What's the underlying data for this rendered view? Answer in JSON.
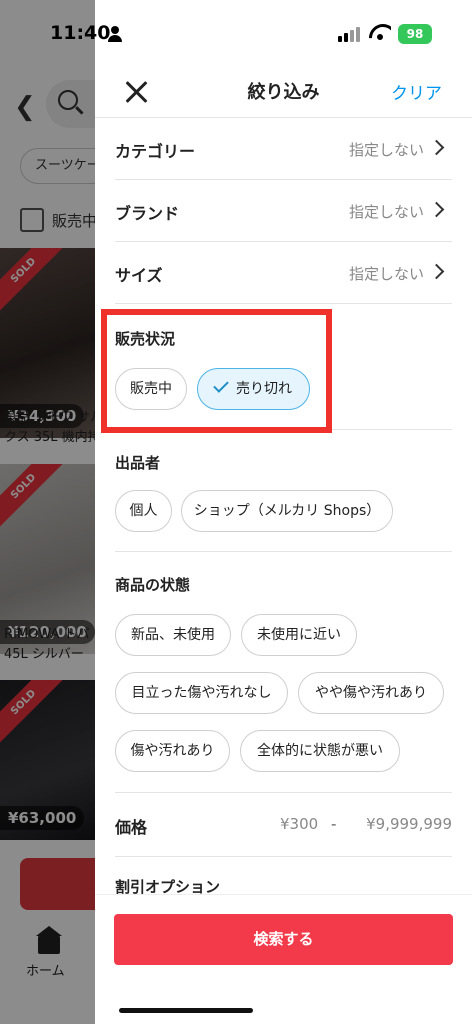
{
  "status_bar": {
    "time": "11:40",
    "battery": "98"
  },
  "background": {
    "chip_text": "スーツケー",
    "checkbox_label": "販売中",
    "sold_label": "SOLD",
    "items": [
      {
        "price": "¥34,300",
        "title_line1": "良品 リモワ サル",
        "title_line2": "クス 35L 機内持"
      },
      {
        "price": "¥120,000",
        "title_line1": "RIMOWA トパ",
        "title_line2": "45L シルバー"
      },
      {
        "price": "¥63,000",
        "title_line1": "",
        "title_line2": ""
      }
    ],
    "nav_home": "ホーム"
  },
  "filter": {
    "title": "絞り込み",
    "clear_label": "クリア",
    "rows": [
      {
        "label": "カテゴリー",
        "value": "指定しない"
      },
      {
        "label": "ブランド",
        "value": "指定しない"
      },
      {
        "label": "サイズ",
        "value": "指定しない"
      }
    ],
    "sales_status": {
      "title": "販売状況",
      "options": [
        {
          "label": "販売中",
          "selected": false
        },
        {
          "label": "売り切れ",
          "selected": true
        }
      ]
    },
    "seller": {
      "title": "出品者",
      "options": [
        "個人",
        "ショップ（メルカリ Shops）"
      ]
    },
    "condition": {
      "title": "商品の状態",
      "options": [
        "新品、未使用",
        "未使用に近い",
        "目立った傷や汚れなし",
        "やや傷や汚れあり",
        "傷や汚れあり",
        "全体的に状態が悪い"
      ]
    },
    "price": {
      "label": "価格",
      "min": "¥300",
      "dash": "-",
      "max": "¥9,999,999"
    },
    "discount_label": "割引オプション",
    "search_button": "検索する"
  },
  "colors": {
    "accent": "#0095ee",
    "primary_button": "#f23a4a",
    "highlight_border": "#f0302a",
    "selected_chip": "#e6f5fd"
  }
}
